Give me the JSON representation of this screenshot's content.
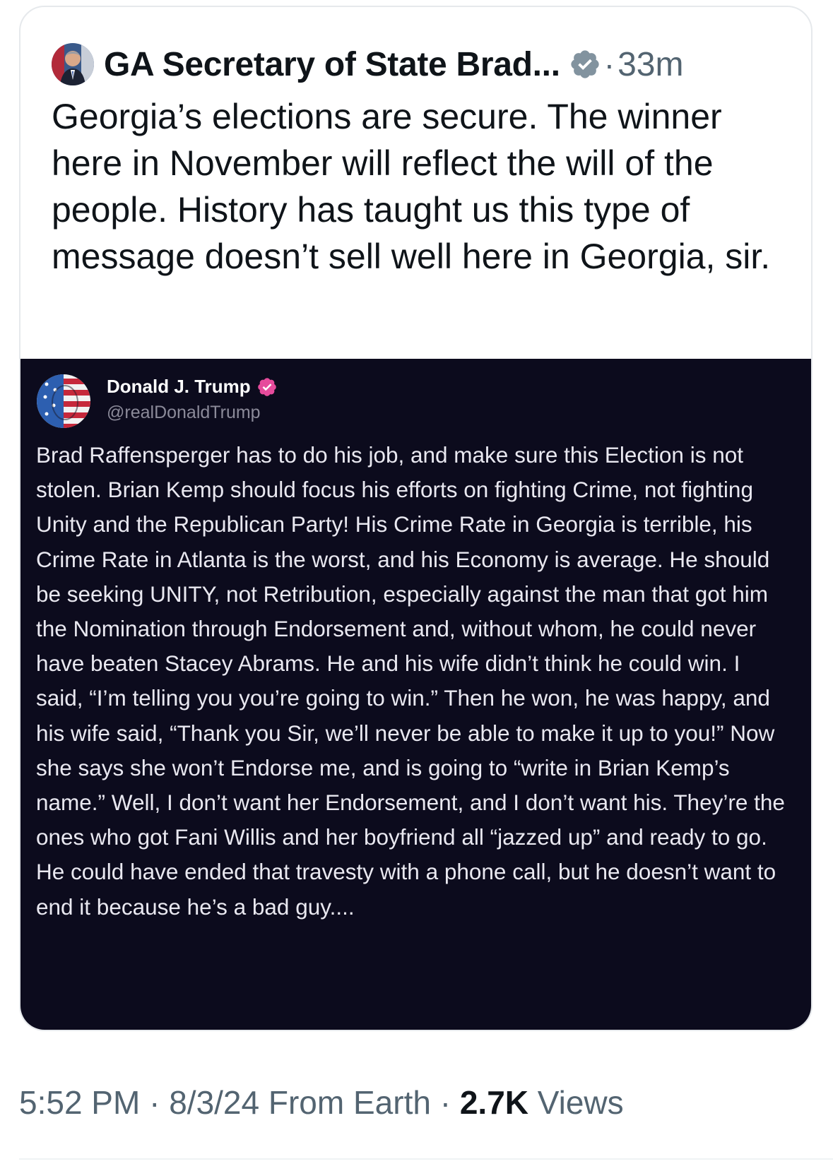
{
  "post": {
    "author_name": "GA Secretary of State Brad...",
    "separator": "·",
    "time_ago": "33m",
    "text": "Georgia’s elections are secure. The winner here in November will reflect the will of the people. History has taught us this type of message doesn’t sell well here in Georgia, sir.",
    "avatar_icon": "profile-photo",
    "verified_icon": "verified-badge-gray"
  },
  "embedded_post": {
    "author_name": "Donald J. Trump",
    "handle": "@realDonaldTrump",
    "verified_icon": "verified-badge-pink",
    "text": "Brad Raffensperger has to do his job, and make sure this Election is not stolen. Brian Kemp should focus his efforts on fighting Crime, not fighting Unity and the Republican Party! His Crime Rate in Georgia is terrible, his Crime Rate in Atlanta is the worst, and his Economy is average. He should be seeking UNITY, not Retribution, especially against the man that got him the Nomination through Endorsement and, without whom, he could never have beaten Stacey Abrams. He and his wife didn’t think he could win. I said, “I’m telling you you’re going to win.” Then he won, he was happy, and his wife said, “Thank you Sir, we’ll never be able to make it up to you!” Now she says she won’t Endorse me, and is going to “write in Brian Kemp’s name.” Well, I don’t want her Endorsement, and I don’t want his. They’re the ones who got Fani Willis and her boyfriend all “jazzed up” and ready to go. He could have ended that travesty with a phone call, but he doesn’t want to end it because he’s a bad guy....",
    "colors": {
      "background": "#0c0b1d",
      "badge": "#e64b9c"
    }
  },
  "footer": {
    "time": "5:52 PM",
    "sep1": " · ",
    "date": "8/3/24",
    "source": " From Earth",
    "sep2": " · ",
    "views_count": "2.7K",
    "views_label": " Views"
  }
}
